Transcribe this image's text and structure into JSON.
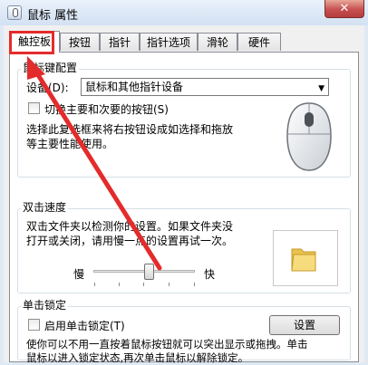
{
  "window": {
    "title": "鼠标 属性",
    "close_symbol": "✕"
  },
  "tabs": [
    {
      "label": "触控板"
    },
    {
      "label": "按钮"
    },
    {
      "label": "指针"
    },
    {
      "label": "指针选项"
    },
    {
      "label": "滑轮"
    },
    {
      "label": "硬件"
    }
  ],
  "button_config": {
    "legend": "鼠标键配置",
    "device_label": "设备(D):",
    "device_value": "鼠标和其他指针设备",
    "switch_checkbox_label": "切换主要和次要的按钮(S)",
    "switch_checked": false,
    "description": [
      "选择此复选框来将右按钮设成如选择和拖放",
      "等主要性能使用。"
    ]
  },
  "double_click": {
    "legend": "双击速度",
    "description": [
      "双击文件夹以检测你的设置。如果文件夹没",
      "打开或关闭，请用慢一点的设置再试一次。"
    ],
    "slow_label": "慢",
    "fast_label": "快",
    "speed_level": 0.55
  },
  "click_lock": {
    "legend": "单击锁定",
    "checkbox_label": "启用单击锁定(T)",
    "checked": false,
    "settings_button": "设置",
    "description": [
      "使你可以不用一直按着鼠标按钮就可以突出显示或拖拽。单击",
      "鼠标以进入锁定状态,再次单击鼠标以解除锁定。"
    ]
  },
  "colors": {
    "annotation": "#e42b2b",
    "folder": "#f3d36b"
  }
}
